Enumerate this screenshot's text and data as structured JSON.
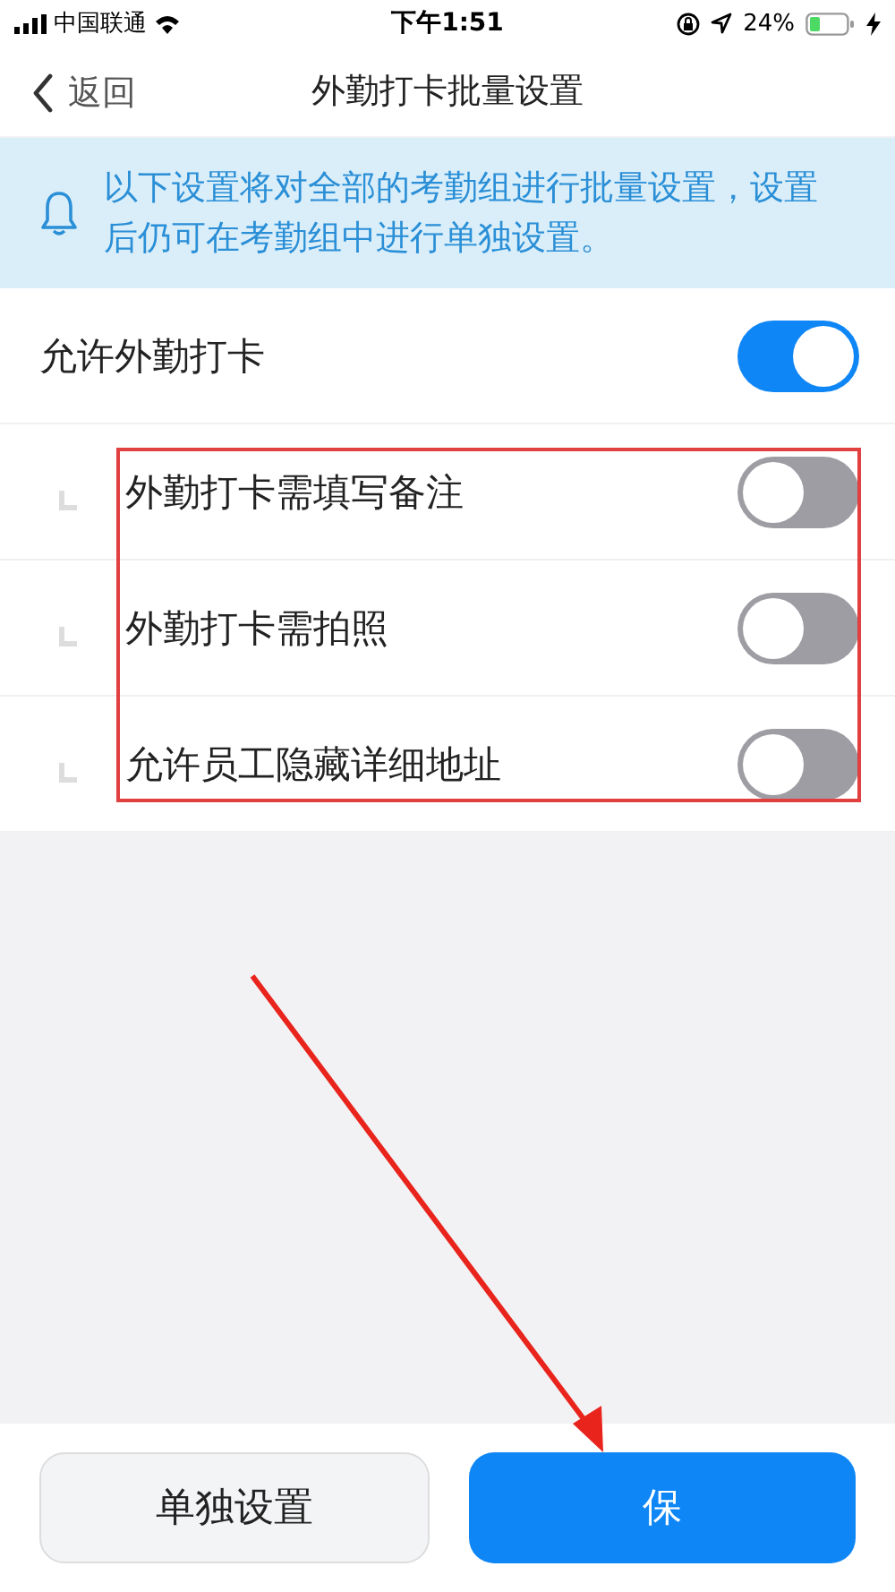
{
  "status_bar": {
    "carrier": "中国联通",
    "time": "下午1:51",
    "battery": "24%"
  },
  "nav": {
    "back": "返回",
    "title": "外勤打卡批量设置"
  },
  "notice": "以下设置将对全部的考勤组进行批量设置，设置后仍可在考勤组中进行单独设置。",
  "settings": [
    {
      "label": "允许外勤打卡",
      "on": true,
      "children": [
        {
          "label": "外勤打卡需填写备注",
          "on": false
        },
        {
          "label": "外勤打卡需拍照",
          "on": false
        },
        {
          "label": "允许员工隐藏详细地址",
          "on": false
        }
      ]
    }
  ],
  "buttons": [
    {
      "label": "单独设置",
      "kind": "secondary"
    },
    {
      "label": "保",
      "kind": "primary"
    }
  ]
}
